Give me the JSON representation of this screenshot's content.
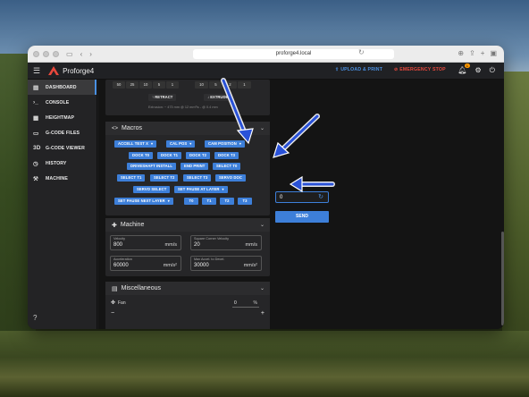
{
  "browser": {
    "url": "proforge4.local"
  },
  "appbar": {
    "brand": "Proforge4",
    "upload_label": "UPLOAD & PRINT",
    "estop_label": "EMERGENCY STOP",
    "notification_count": "1",
    "colors": {
      "accent": "#3d7fd9",
      "estop": "#e8483c",
      "badge": "#ff9800"
    }
  },
  "sidebar": {
    "items": [
      {
        "label": "DASHBOARD",
        "icon": "dashboard-icon",
        "active": true
      },
      {
        "label": "CONSOLE",
        "icon": "console-icon"
      },
      {
        "label": "HEIGHTMAP",
        "icon": "heightmap-icon"
      },
      {
        "label": "G-CODE FILES",
        "icon": "file-icon"
      },
      {
        "label": "G-CODE VIEWER",
        "icon": "viewer-icon"
      },
      {
        "label": "HISTORY",
        "icon": "history-icon"
      },
      {
        "label": "MACHINE",
        "icon": "machine-icon"
      }
    ]
  },
  "extruder": {
    "amounts_left": [
      "50",
      "25",
      "10",
      "5",
      "1"
    ],
    "amounts_right": [
      "10",
      "5",
      "2",
      "1"
    ],
    "retract_label": "RETRACT",
    "extrude_label": "EXTRUDE",
    "info": "Extrusion: ~ 473 mm @ 12 mm³/s - @ 0.4 mm"
  },
  "macros": {
    "title": "Macros",
    "rows": [
      [
        "ACCELL TEST X",
        "CAL POS",
        "CAM POSITION"
      ],
      [
        "DOCK T0",
        "DOCK T1",
        "DOCK T2",
        "DOCK T3"
      ],
      [
        "DRIVESHAFT INSTALL",
        "END PRINT",
        "SELECT T0"
      ],
      [
        "SELECT T1",
        "SELECT T2",
        "SELECT T3",
        "SERVO DOC"
      ],
      [
        "SERVO SELECT",
        "SET PAUSE AT LAYER"
      ],
      [
        "SET PAUSE NEXT LAYER",
        "T0",
        "T1",
        "T2",
        "T3"
      ]
    ],
    "popup_value": "0",
    "send_label": "SEND"
  },
  "machine": {
    "title": "Machine",
    "velocity": {
      "label": "Velocity",
      "value": "800",
      "unit": "mm/s"
    },
    "scv": {
      "label": "Square Corner Velocity",
      "value": "20",
      "unit": "mm/s"
    },
    "accel": {
      "label": "Acceleration",
      "value": "60000",
      "unit": "mm/s²"
    },
    "accel_decel": {
      "label": "Max Accel. to Decel.",
      "value": "30000",
      "unit": "mm/s²"
    }
  },
  "misc": {
    "title": "Miscellaneous",
    "fan_label": "Fan",
    "fan_value": "0",
    "fan_unit": "%",
    "fan_level": 0
  }
}
